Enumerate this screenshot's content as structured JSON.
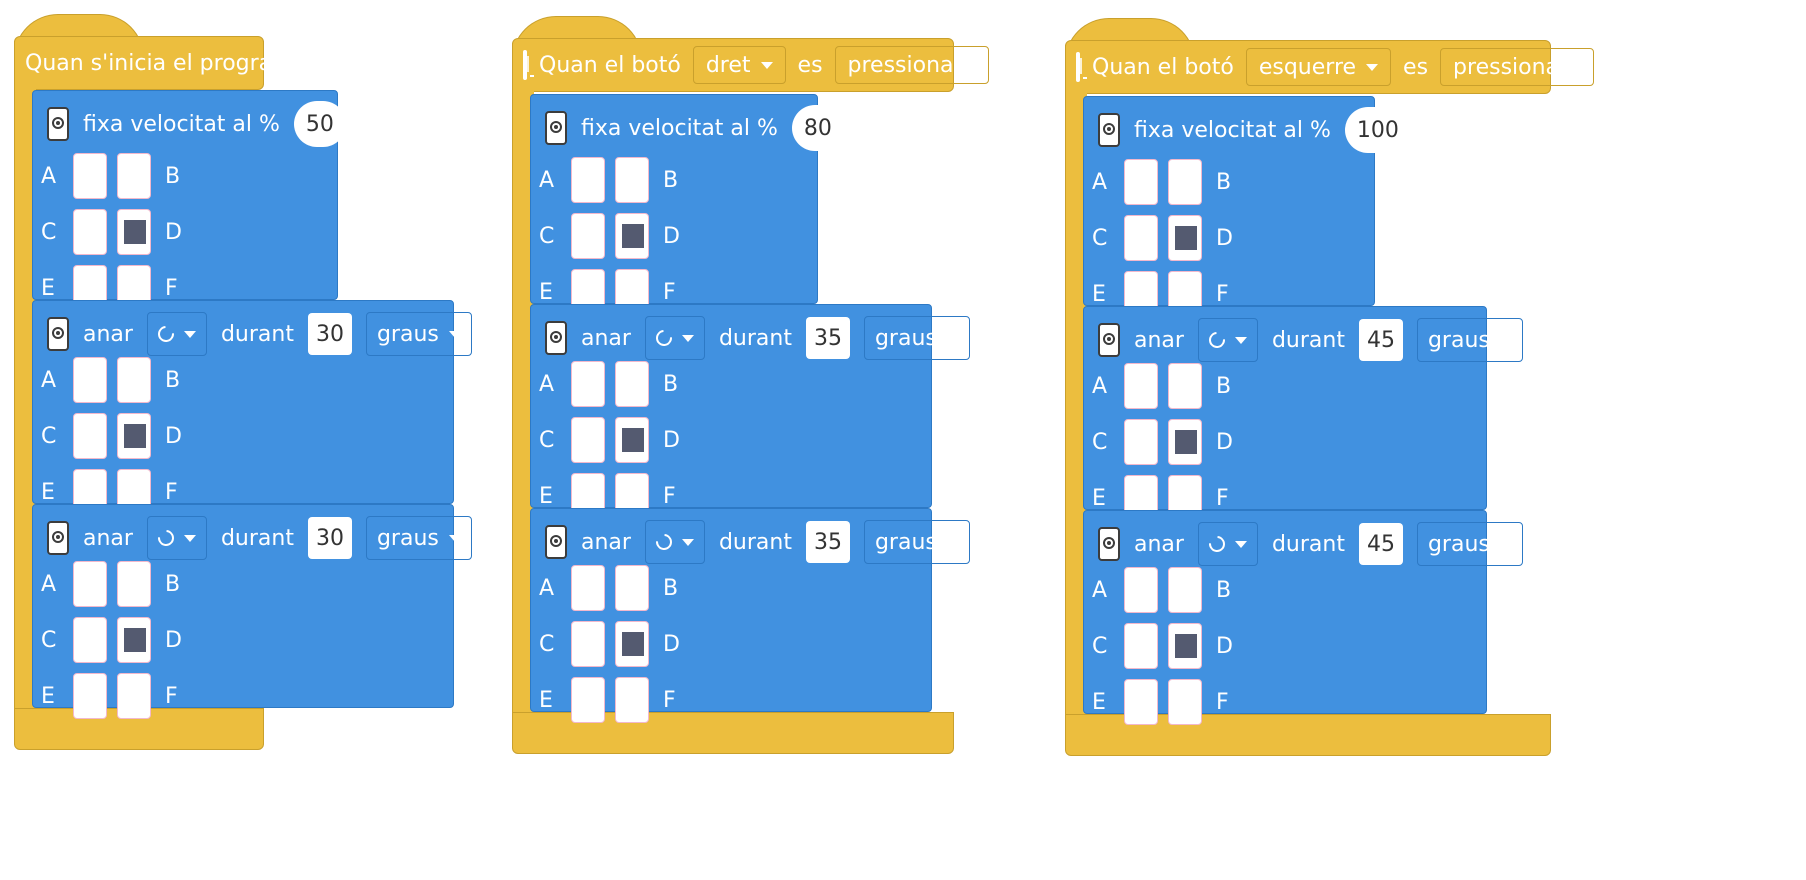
{
  "colors": {
    "event": "#ECBE3E",
    "motion": "#4191E0",
    "filled_port": "#545A70"
  },
  "icons": {
    "event_device": "phone-icon",
    "motor": "motor-hub-icon",
    "ccw": "rotate-ccw-icon",
    "cw": "rotate-cw-icon"
  },
  "scripts": [
    {
      "label": "Quan s'inicia el programa",
      "blocks": [
        {
          "kind": "speed",
          "label": "fixa velocitat al %",
          "value": "50",
          "ports": {
            "labels_left": [
              "A",
              "C",
              "E"
            ],
            "labels_right": [
              "B",
              "D",
              "F"
            ],
            "selected": "D"
          }
        },
        {
          "kind": "move",
          "label": "anar",
          "direction_icon": "rotate-ccw-icon",
          "during": "durant",
          "amount": "30",
          "unit": "graus",
          "ports": {
            "labels_left": [
              "A",
              "C",
              "E"
            ],
            "labels_right": [
              "B",
              "D",
              "F"
            ],
            "selected": "D"
          }
        },
        {
          "kind": "move",
          "label": "anar",
          "direction_icon": "rotate-cw-icon",
          "during": "durant",
          "amount": "30",
          "unit": "graus",
          "ports": {
            "labels_left": [
              "A",
              "C",
              "E"
            ],
            "labels_right": [
              "B",
              "D",
              "F"
            ],
            "selected": "D"
          }
        }
      ]
    },
    {
      "label_pre": "Quan el botó",
      "button": "dret",
      "label_mid": "es",
      "action": "pressiona",
      "blocks": [
        {
          "kind": "speed",
          "label": "fixa velocitat al %",
          "value": "80",
          "ports": {
            "labels_left": [
              "A",
              "C",
              "E"
            ],
            "labels_right": [
              "B",
              "D",
              "F"
            ],
            "selected": "D"
          }
        },
        {
          "kind": "move",
          "label": "anar",
          "direction_icon": "rotate-ccw-icon",
          "during": "durant",
          "amount": "35",
          "unit": "graus",
          "ports": {
            "labels_left": [
              "A",
              "C",
              "E"
            ],
            "labels_right": [
              "B",
              "D",
              "F"
            ],
            "selected": "D"
          }
        },
        {
          "kind": "move",
          "label": "anar",
          "direction_icon": "rotate-cw-icon",
          "during": "durant",
          "amount": "35",
          "unit": "graus",
          "ports": {
            "labels_left": [
              "A",
              "C",
              "E"
            ],
            "labels_right": [
              "B",
              "D",
              "F"
            ],
            "selected": "D"
          }
        }
      ]
    },
    {
      "label_pre": "Quan el botó",
      "button": "esquerre",
      "label_mid": "es",
      "action": "pressiona",
      "blocks": [
        {
          "kind": "speed",
          "label": "fixa velocitat al %",
          "value": "100",
          "ports": {
            "labels_left": [
              "A",
              "C",
              "E"
            ],
            "labels_right": [
              "B",
              "D",
              "F"
            ],
            "selected": "D"
          }
        },
        {
          "kind": "move",
          "label": "anar",
          "direction_icon": "rotate-ccw-icon",
          "during": "durant",
          "amount": "45",
          "unit": "graus",
          "ports": {
            "labels_left": [
              "A",
              "C",
              "E"
            ],
            "labels_right": [
              "B",
              "D",
              "F"
            ],
            "selected": "D"
          }
        },
        {
          "kind": "move",
          "label": "anar",
          "direction_icon": "rotate-cw-icon",
          "during": "durant",
          "amount": "45",
          "unit": "graus",
          "ports": {
            "labels_left": [
              "A",
              "C",
              "E"
            ],
            "labels_right": [
              "B",
              "D",
              "F"
            ],
            "selected": "D"
          }
        }
      ]
    }
  ]
}
